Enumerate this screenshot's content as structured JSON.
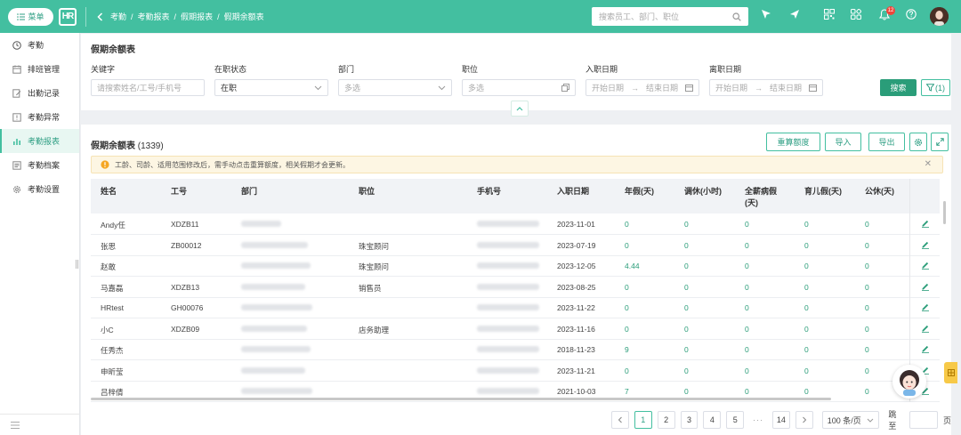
{
  "topbar": {
    "menu_label": "菜单",
    "logo_text": "HR",
    "breadcrumbs": [
      "考勤",
      "/",
      "考勤报表",
      "/",
      "假期报表",
      "/",
      "假期余额表"
    ],
    "search_placeholder": "搜索员工、部门、职位",
    "notification_count": "12",
    "accent_color": "#43bfa0"
  },
  "sidebar": {
    "header": "考勤",
    "items": [
      {
        "label": "排班管理",
        "icon": "calendar-icon"
      },
      {
        "label": "出勤记录",
        "icon": "edit-doc-icon"
      },
      {
        "label": "考勤异常",
        "icon": "warning-doc-icon"
      },
      {
        "label": "考勤报表",
        "icon": "chart-icon",
        "active": true
      },
      {
        "label": "考勤档案",
        "icon": "archive-icon"
      },
      {
        "label": "考勤设置",
        "icon": "gear-icon"
      }
    ]
  },
  "filters": {
    "title": "假期余额表",
    "keyword": {
      "label": "关键字",
      "placeholder": "请搜索姓名/工号/手机号"
    },
    "status": {
      "label": "在职状态",
      "value": "在职"
    },
    "department": {
      "label": "部门",
      "placeholder": "多选"
    },
    "position": {
      "label": "职位",
      "placeholder": "多选"
    },
    "hire_date": {
      "label": "入职日期",
      "start": "开始日期",
      "arrow": "→",
      "end": "结束日期"
    },
    "leave_date": {
      "label": "离职日期",
      "start": "开始日期",
      "arrow": "→",
      "end": "结束日期"
    },
    "search_label": "搜索",
    "filter_label": "(1)"
  },
  "table": {
    "title": "假期余额表",
    "count": "(1339)",
    "actions": {
      "recalc": "重算额度",
      "import": "导入",
      "export": "导出"
    },
    "notice": "工龄、司龄、适用范围修改后，需手动点击重算额度，相关假期才会更新。",
    "columns": [
      "姓名",
      "工号",
      "部门",
      "职位",
      "手机号",
      "入职日期",
      "年假(天)",
      "调休(小时)",
      "全薪病假",
      "(天)",
      "育儿假(天)",
      "公休(天)"
    ],
    "rows": [
      {
        "name": "Andy任",
        "id": "XDZB11",
        "position": "",
        "date": "2023-11-01",
        "annual": "0",
        "comp": "0",
        "sick": "0",
        "child": "0",
        "public": "0"
      },
      {
        "name": "张思",
        "id": "ZB00012",
        "position": "珠宝顾问",
        "date": "2023-07-19",
        "annual": "0",
        "comp": "0",
        "sick": "0",
        "child": "0",
        "public": "0"
      },
      {
        "name": "赵敢",
        "id": "",
        "position": "珠宝顾问",
        "date": "2023-12-05",
        "annual": "4.44",
        "comp": "0",
        "sick": "0",
        "child": "0",
        "public": "0"
      },
      {
        "name": "马嘉磊",
        "id": "XDZB13",
        "position": "销售员",
        "date": "2023-08-25",
        "annual": "0",
        "comp": "0",
        "sick": "0",
        "child": "0",
        "public": "0"
      },
      {
        "name": "HRtest",
        "id": "GH00076",
        "position": "",
        "date": "2023-11-22",
        "annual": "0",
        "comp": "0",
        "sick": "0",
        "child": "0",
        "public": "0"
      },
      {
        "name": "小C",
        "id": "XDZB09",
        "position": "店务助理",
        "date": "2023-11-16",
        "annual": "0",
        "comp": "0",
        "sick": "0",
        "child": "0",
        "public": "0"
      },
      {
        "name": "任秀杰",
        "id": "",
        "position": "",
        "date": "2018-11-23",
        "annual": "9",
        "comp": "0",
        "sick": "0",
        "child": "0",
        "public": "0"
      },
      {
        "name": "申昕莹",
        "id": "",
        "position": "",
        "date": "2023-11-21",
        "annual": "0",
        "comp": "0",
        "sick": "0",
        "child": "0",
        "public": "0"
      },
      {
        "name": "吕梓倩",
        "id": "",
        "position": "",
        "date": "2021-10-03",
        "annual": "7",
        "comp": "0",
        "sick": "0",
        "child": "0",
        "public": "0"
      }
    ]
  },
  "pagination": {
    "pages": [
      "1",
      "2",
      "3",
      "4",
      "5",
      "···",
      "14"
    ],
    "page_size": "100 条/页",
    "jump_label": "跳至",
    "jump_suffix": "页"
  }
}
